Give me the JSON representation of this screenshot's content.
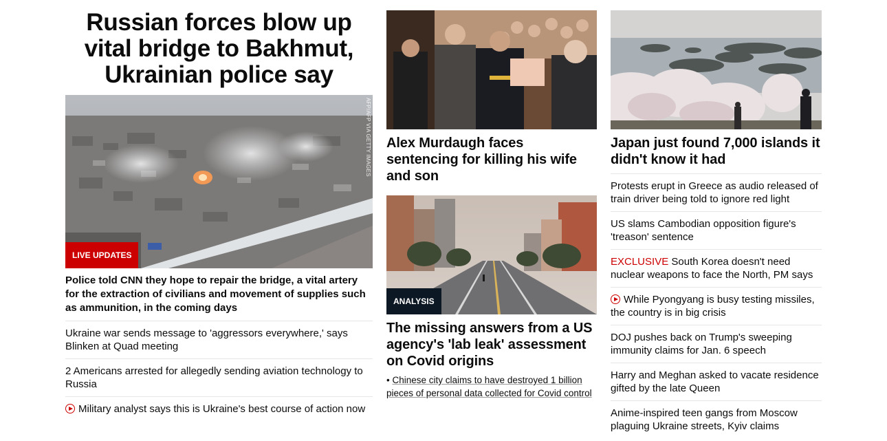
{
  "lead": {
    "headline": "Russian forces blow up vital bridge to Bakhmut, Ukrainian police say",
    "image_credit": "AFP/AFP VIA GETTY IMAGES",
    "badge": "LIVE UPDATES",
    "summary": "Police told CNN they hope to repair the bridge, a vital artery for the extraction of civilians and movement of supplies such as ammunition, in the coming days",
    "related": [
      "Ukraine war sends message to 'aggressors everywhere,' says Blinken at Quad meeting",
      "2 Americans arrested for allegedly sending aviation technology to Russia",
      "Military analyst says this is Ukraine's best course of action now"
    ]
  },
  "middle": {
    "story1_title": "Alex Murdaugh faces sentencing for killing his wife and son",
    "story2_badge": "ANALYSIS",
    "story2_title": "The missing answers from a US agency's 'lab leak' assessment on Covid origins",
    "story2_sublink_bullet": "•",
    "story2_sublink": "Chinese city claims to have destroyed 1 billion pieces of personal data collected for Covid control"
  },
  "right": {
    "title": "Japan just found 7,000 islands it didn't know it had",
    "items": [
      {
        "text": "Protests erupt in Greece as audio released of train driver being told to ignore red light"
      },
      {
        "text": "US slams Cambodian opposition figure's 'treason' sentence"
      },
      {
        "label": "EXCLUSIVE",
        "text": "South Korea doesn't need nuclear weapons to face the North, PM says"
      },
      {
        "text": "While Pyongyang is busy testing missiles, the country is in big crisis",
        "video": true
      },
      {
        "text": "DOJ pushes back on Trump's sweeping immunity claims for Jan. 6 speech"
      },
      {
        "text": "Harry and Meghan asked to vacate residence gifted by the late Queen"
      },
      {
        "text": "Anime-inspired teen gangs from Moscow plaguing Ukraine streets, Kyiv claims"
      }
    ]
  },
  "colors": {
    "accent_red": "#cc0000",
    "analysis_badge": "#0c1824",
    "divider": "#e6e6e6"
  }
}
